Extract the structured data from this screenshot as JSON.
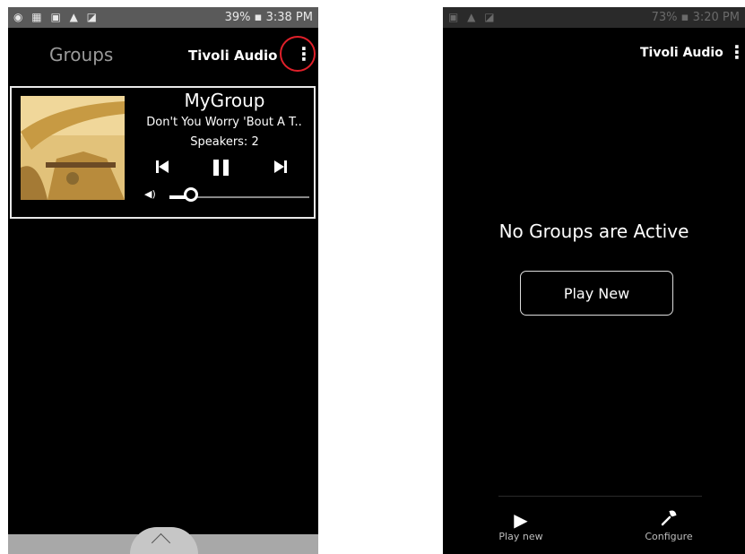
{
  "left_screen": {
    "status_bar": {
      "left_icons": "◉ ▦ ▣ ▲ ◪",
      "right_text": "39% ▪ 3:38 PM"
    },
    "app_bar": {
      "title": "Groups",
      "brand": "Tivoli Audio",
      "menu_icon": "⋮"
    },
    "group_card": {
      "name": "MyGroup",
      "track": "Don't You Worry 'Bout A T..",
      "speakers": "Speakers: 2",
      "volume_fraction": 0.12
    },
    "bottom_tab": {
      "icon": "chevron-up-icon"
    }
  },
  "right_screen": {
    "status_bar": {
      "left_icons": "▣ ▲ ◪",
      "right_text": "73% ▪ 3:20 PM"
    },
    "app_bar": {
      "brand": "Tivoli Audio",
      "menu_icon": "⋮"
    },
    "message": "No Groups are Active",
    "play_new_button": "Play New",
    "bottom_nav": [
      {
        "label": "Play new",
        "icon": "play-icon"
      },
      {
        "label": "Configure",
        "icon": "wrench-icon"
      }
    ]
  },
  "colors": {
    "highlight_circle": "#e0202a",
    "background": "#000000"
  }
}
